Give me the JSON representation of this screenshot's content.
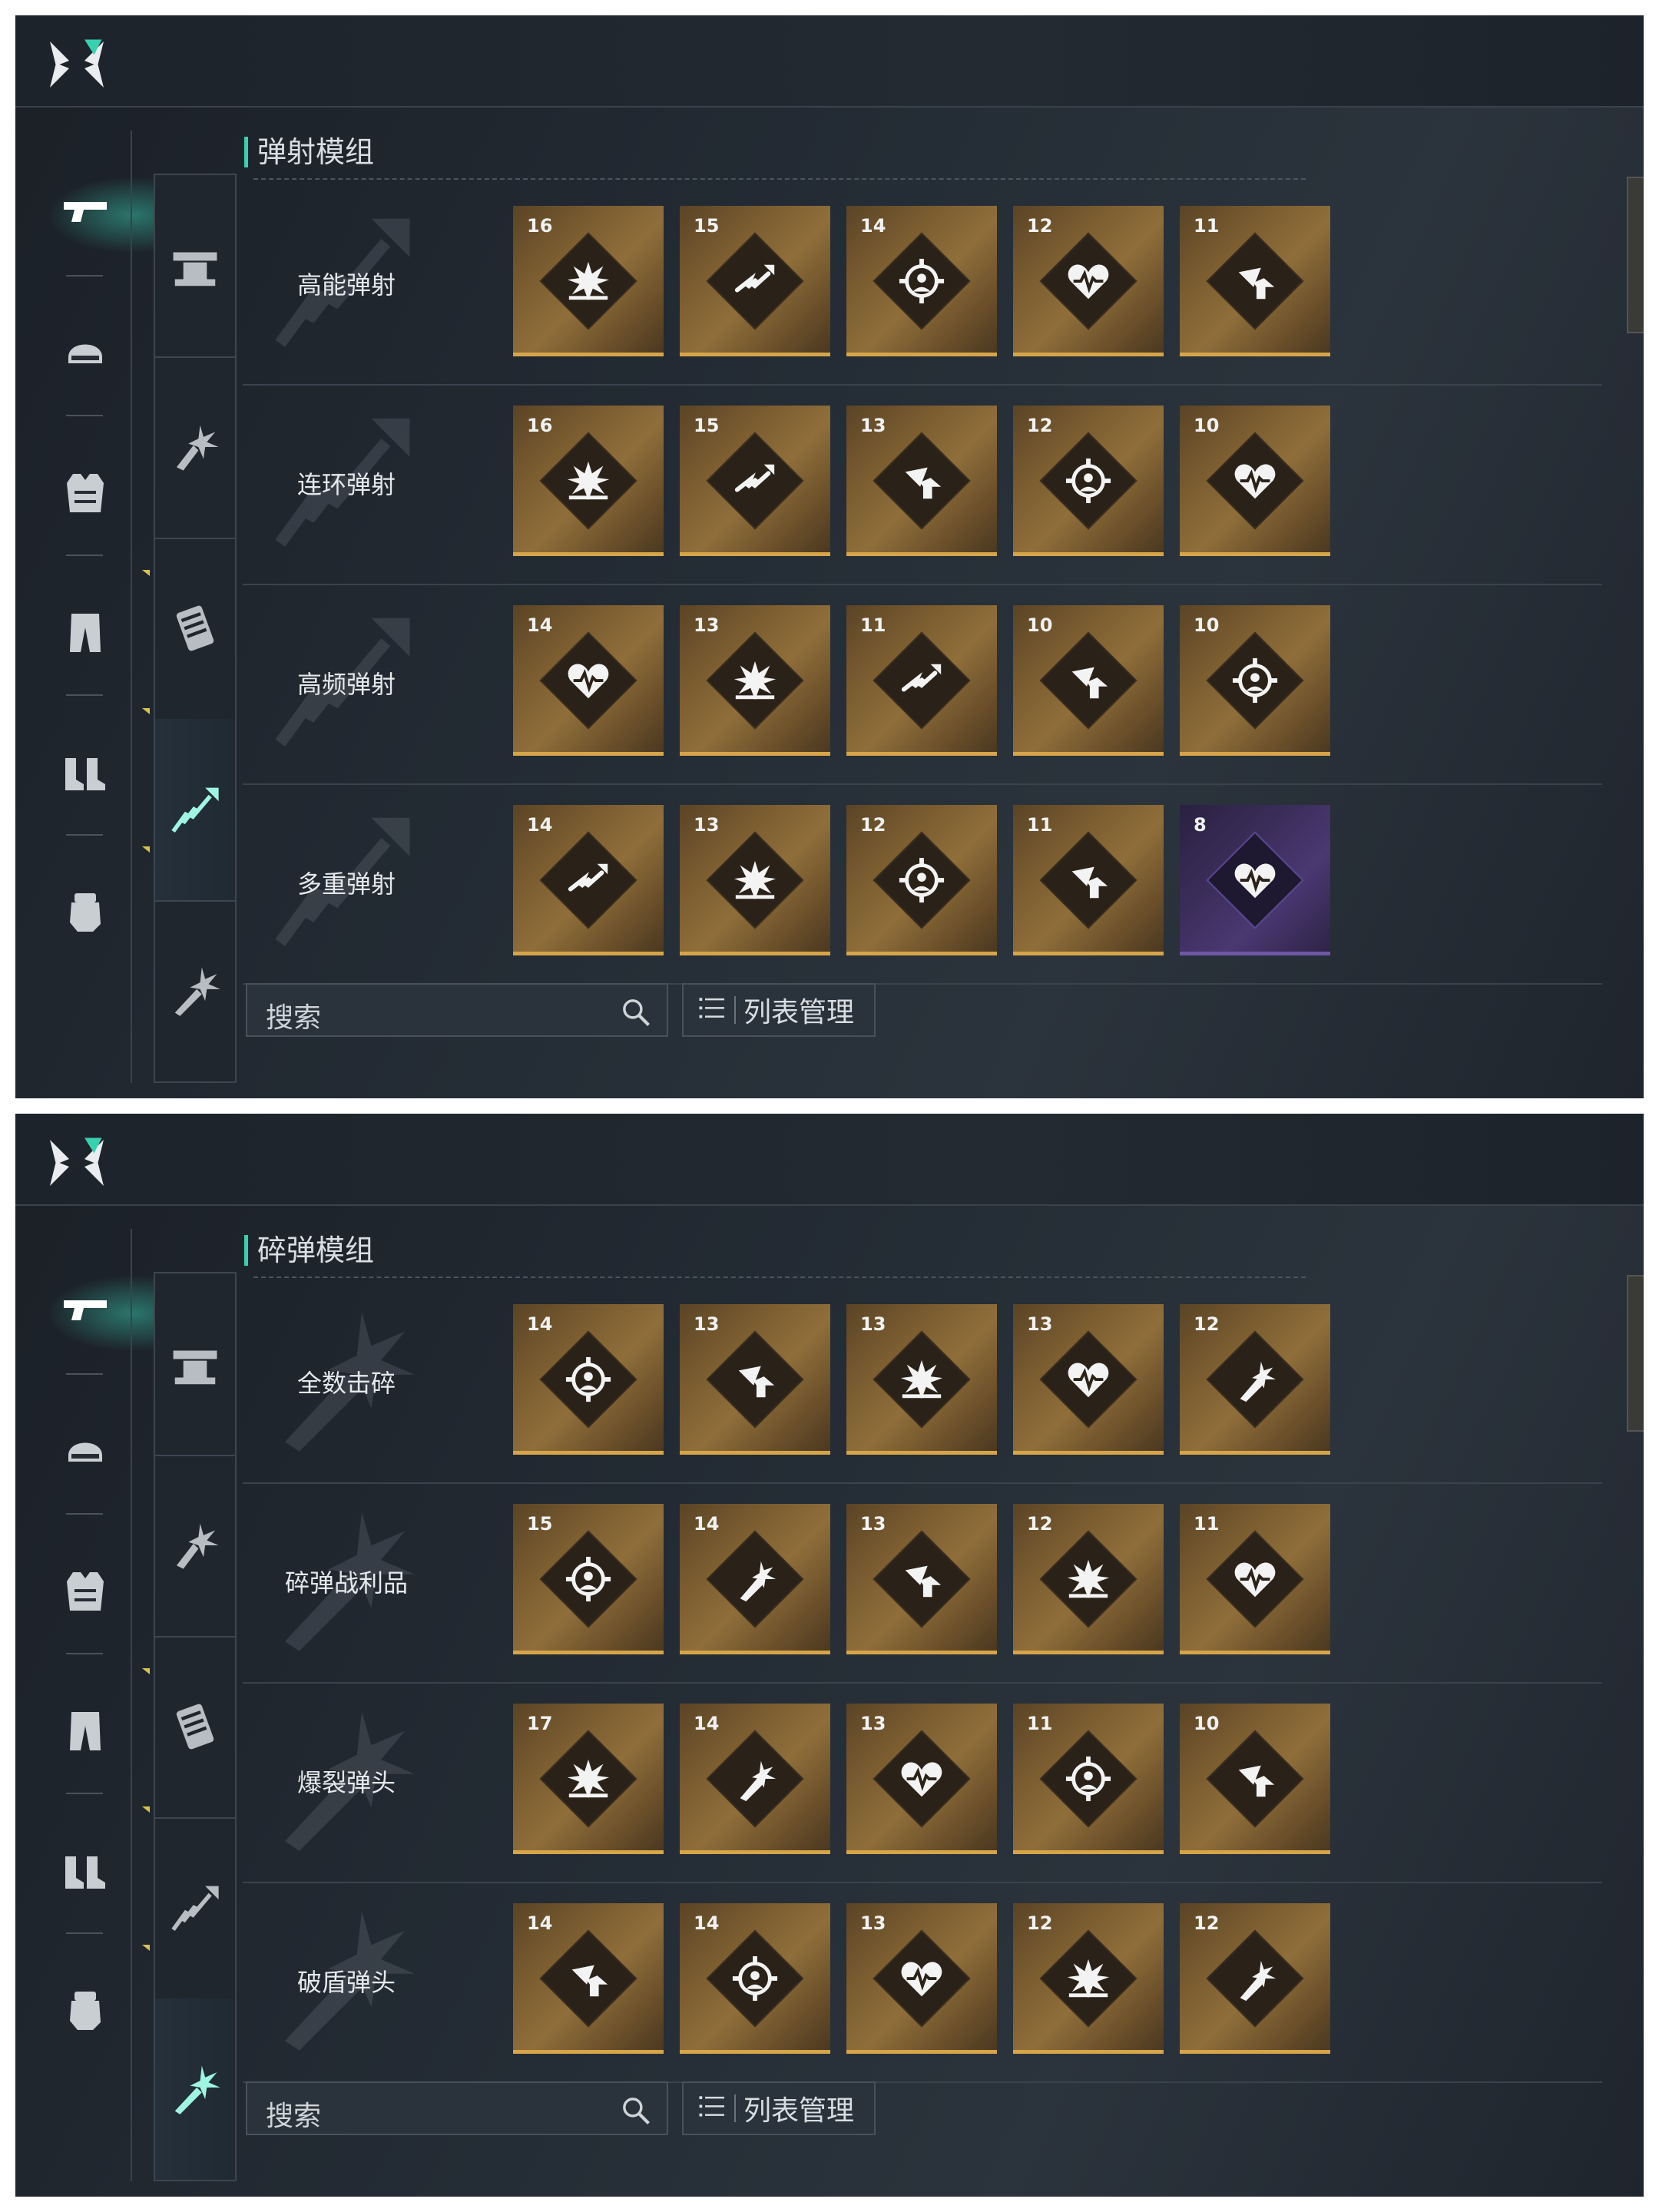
{
  "panels": [
    {
      "section_title": "弹射模组",
      "search_placeholder": "搜索",
      "list_button_label": "列表管理",
      "active_subnav": 3,
      "rows": [
        {
          "name": "高能弹射",
          "cards": [
            {
              "level": "16",
              "icon": "explosion"
            },
            {
              "level": "15",
              "icon": "ricochet"
            },
            {
              "level": "14",
              "icon": "target"
            },
            {
              "level": "12",
              "icon": "heart"
            },
            {
              "level": "11",
              "icon": "boost"
            }
          ]
        },
        {
          "name": "连环弹射",
          "cards": [
            {
              "level": "16",
              "icon": "explosion"
            },
            {
              "level": "15",
              "icon": "ricochet"
            },
            {
              "level": "13",
              "icon": "boost"
            },
            {
              "level": "12",
              "icon": "target"
            },
            {
              "level": "10",
              "icon": "heart"
            }
          ]
        },
        {
          "name": "高频弹射",
          "cards": [
            {
              "level": "14",
              "icon": "heart"
            },
            {
              "level": "13",
              "icon": "explosion"
            },
            {
              "level": "11",
              "icon": "ricochet"
            },
            {
              "level": "10",
              "icon": "boost"
            },
            {
              "level": "10",
              "icon": "target"
            }
          ]
        },
        {
          "name": "多重弹射",
          "cards": [
            {
              "level": "14",
              "icon": "ricochet"
            },
            {
              "level": "13",
              "icon": "explosion"
            },
            {
              "level": "12",
              "icon": "target"
            },
            {
              "level": "11",
              "icon": "boost"
            },
            {
              "level": "8",
              "icon": "heart",
              "rarity": "purple"
            }
          ]
        }
      ]
    },
    {
      "section_title": "碎弹模组",
      "search_placeholder": "搜索",
      "list_button_label": "列表管理",
      "active_subnav": 4,
      "rows": [
        {
          "name": "全数击碎",
          "cards": [
            {
              "level": "14",
              "icon": "target"
            },
            {
              "level": "13",
              "icon": "boost"
            },
            {
              "level": "13",
              "icon": "explosion"
            },
            {
              "level": "13",
              "icon": "heart"
            },
            {
              "level": "12",
              "icon": "shatter"
            }
          ]
        },
        {
          "name": "碎弹战利品",
          "cards": [
            {
              "level": "15",
              "icon": "target"
            },
            {
              "level": "14",
              "icon": "shatter"
            },
            {
              "level": "13",
              "icon": "boost"
            },
            {
              "level": "12",
              "icon": "explosion"
            },
            {
              "level": "11",
              "icon": "heart"
            }
          ]
        },
        {
          "name": "爆裂弹头",
          "cards": [
            {
              "level": "17",
              "icon": "explosion"
            },
            {
              "level": "14",
              "icon": "shatter"
            },
            {
              "level": "13",
              "icon": "heart"
            },
            {
              "level": "11",
              "icon": "target"
            },
            {
              "level": "10",
              "icon": "boost"
            }
          ]
        },
        {
          "name": "破盾弹头",
          "cards": [
            {
              "level": "14",
              "icon": "boost"
            },
            {
              "level": "14",
              "icon": "target"
            },
            {
              "level": "13",
              "icon": "heart"
            },
            {
              "level": "12",
              "icon": "explosion"
            },
            {
              "level": "12",
              "icon": "shatter"
            }
          ]
        }
      ]
    }
  ],
  "left_nav": [
    "pistol-icon",
    "helmet-icon",
    "vest-icon",
    "pants-icon",
    "boots-icon",
    "gloves-icon"
  ],
  "sub_nav": [
    "turret-icon",
    "burst-icon",
    "ammo-clip-icon",
    "ricochet-icon",
    "shatter-icon"
  ],
  "colors": {
    "accent": "#38d1b0",
    "gold_card": "#8f6e3a",
    "purple_card": "#4a3872",
    "badge": "#d8c24a"
  }
}
